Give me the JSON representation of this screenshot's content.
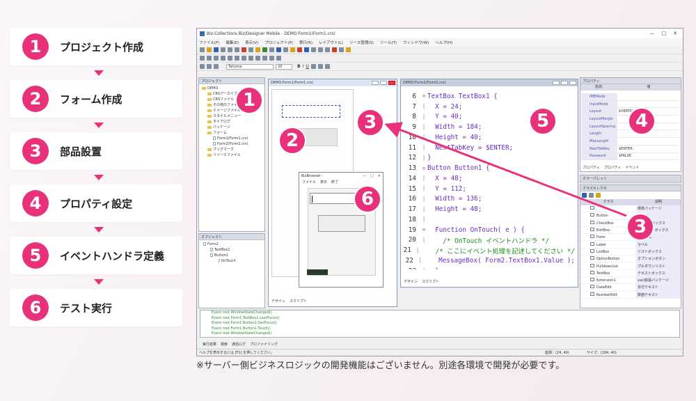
{
  "steps": [
    {
      "num": "1",
      "label": "プロジェクト作成"
    },
    {
      "num": "2",
      "label": "フォーム作成"
    },
    {
      "num": "3",
      "label": "部品設置"
    },
    {
      "num": "4",
      "label": "プロパティ設定"
    },
    {
      "num": "5",
      "label": "イベントハンドラ定義"
    },
    {
      "num": "6",
      "label": "テスト実行"
    }
  ],
  "app": {
    "title": "Biz-Collections Biz/Designer Mobile - DEMO:Form1(Form1.crs)",
    "menu": [
      "ファイル(F)",
      "編集(E)",
      "表示(V)",
      "プロジェクト(P)",
      "実行(R)",
      "レイアウト(L)",
      "ソース管理(S)",
      "ツール(T)",
      "ウィンドウ(W)",
      "ヘルプ(H)"
    ],
    "font_name": "Tahoma",
    "font_size": "20",
    "project_panel": {
      "title": "プロジェクト",
      "items": [
        "DEMO",
        "CRSアーカイブ",
        "CRSファイル",
        "その他のファイル",
        "イメージファイル",
        "スタイルメニュー",
        "ダイアログ",
        "パッケージ",
        "フォーム",
        "Form1(Form1.crs)",
        "Form2(Form2.crs)",
        "ブックマーク",
        "リソースファイル"
      ]
    },
    "object_panel": {
      "title": "オブジェクト",
      "items": [
        "Form2",
        "TextBox1",
        "Button1",
        "OnTouch"
      ]
    },
    "form_window": {
      "title": "DEMO:Form1(Form1.crs)"
    },
    "code_window": {
      "title": "DEMO:Form2(Form2.crs)",
      "lines": [
        {
          "n": "6",
          "t": "TextBox TextBox1 {",
          "cls": "kw",
          "i": 0
        },
        {
          "n": "7",
          "t": "X = 24;",
          "cls": "kw",
          "i": 1
        },
        {
          "n": "8",
          "t": "Y = 40;",
          "cls": "kw",
          "i": 1
        },
        {
          "n": "9",
          "t": "Width = 184;",
          "cls": "kw",
          "i": 1
        },
        {
          "n": "10",
          "t": "Height = 40;",
          "cls": "kw",
          "i": 1
        },
        {
          "n": "11",
          "t": "NextTabKey = $ENTER;",
          "cls": "kw",
          "i": 1
        },
        {
          "n": "12",
          "t": "}",
          "cls": "kw",
          "i": 0
        },
        {
          "n": "13",
          "t": "Button Button1 {",
          "cls": "kw",
          "i": 0
        },
        {
          "n": "14",
          "t": "X = 48;",
          "cls": "kw",
          "i": 1
        },
        {
          "n": "15",
          "t": "Y = 112;",
          "cls": "kw",
          "i": 1
        },
        {
          "n": "16",
          "t": "Width = 136;",
          "cls": "kw",
          "i": 1
        },
        {
          "n": "17",
          "t": "Height = 48;",
          "cls": "kw",
          "i": 1
        },
        {
          "n": "18",
          "t": "",
          "cls": "kw",
          "i": 0
        },
        {
          "n": "19",
          "t": "Function OnTouch( e ) {",
          "cls": "kw",
          "i": 1
        },
        {
          "n": "20",
          "t": "/* OnTouch イベントハンドラ */",
          "cls": "cm",
          "i": 2
        },
        {
          "n": "21",
          "t": "/* ここにイベント処理を記述してください */",
          "cls": "cm",
          "i": 2
        },
        {
          "n": "22",
          "t": "MessageBox( Form2.TextBox1.Value );",
          "cls": "kw",
          "i": 2
        },
        {
          "n": "23",
          "t": "}",
          "cls": "kw",
          "i": 1
        },
        {
          "n": "24",
          "t": "}",
          "cls": "kw",
          "i": 0
        }
      ]
    },
    "browser": {
      "title": "BizBrowser -",
      "menu": [
        "ファイル",
        "表示",
        "終了"
      ]
    },
    "property_panel": {
      "title": "プロパティ",
      "col_name": "名前",
      "col_value": "値",
      "rows": [
        [
          "IMEMode",
          ""
        ],
        [
          "InputMode",
          ""
        ],
        [
          "Layout",
          "$VERTIC"
        ],
        [
          "LayoutMargin",
          ""
        ],
        [
          "LayoutSpacing",
          ""
        ],
        [
          "Length",
          ""
        ],
        [
          "MaxLength",
          ""
        ],
        [
          "NextTabKey",
          "$ENTER"
        ],
        [
          "Password",
          "$FALSE"
        ]
      ],
      "tabs": [
        "プロパティ",
        "プロパティ",
        "イベント"
      ]
    },
    "color_panel": {
      "title": "カラーパレット"
    },
    "class_panel": {
      "title": "クラスセレクタ",
      "col_class": "クラス",
      "col_desc": "説明",
      "rows": [
        [
          "",
          "標準パッケージ"
        ],
        [
          "Button",
          "ボタン"
        ],
        [
          "CheckBox",
          "チェックボックス"
        ],
        [
          "EditBox",
          "エディットボックス"
        ],
        [
          "Form",
          "フォーム"
        ],
        [
          "Label",
          "ラベル"
        ],
        [
          "ListBox",
          "リストボックス"
        ],
        [
          "OptionButton",
          "オプションボタン"
        ],
        [
          "PulldownList",
          "プルダウンリスト"
        ],
        [
          "TextBox",
          "テキストボックス"
        ],
        [
          "Extension1",
          "vacl拡張パッケージ"
        ],
        [
          "DateEdit",
          "日付テキスト"
        ],
        [
          "NumberEdit",
          "数値テキスト"
        ]
      ]
    },
    "output": [
      "Event root.WindowStateChanged()",
      "Event root.Form1.TextBox1.LostFocus()",
      "Event root.Form1.Button1.GetFocus()",
      "Event root.Form1.Button1.Touch()",
      "Event root.WindowStateChanged()"
    ],
    "output_tabs": [
      "実行結果",
      "検索",
      "通信ログ",
      "プロファイリング"
    ],
    "design_tab": "デザイン",
    "script_tab": "スクリプト",
    "status_left": "ヘルプを表示するには [F1] を押してください。",
    "status_pos": "座標：(24, 40)",
    "status_size": "サイズ：(184, 40)"
  },
  "badges": [
    "1",
    "2",
    "3",
    "3",
    "4",
    "5",
    "6"
  ],
  "note": "※サーバー側ビジネスロジックの開発機能はございません。別途各環境で開発が必要です。",
  "colors": {
    "accent": "#e8317a"
  }
}
